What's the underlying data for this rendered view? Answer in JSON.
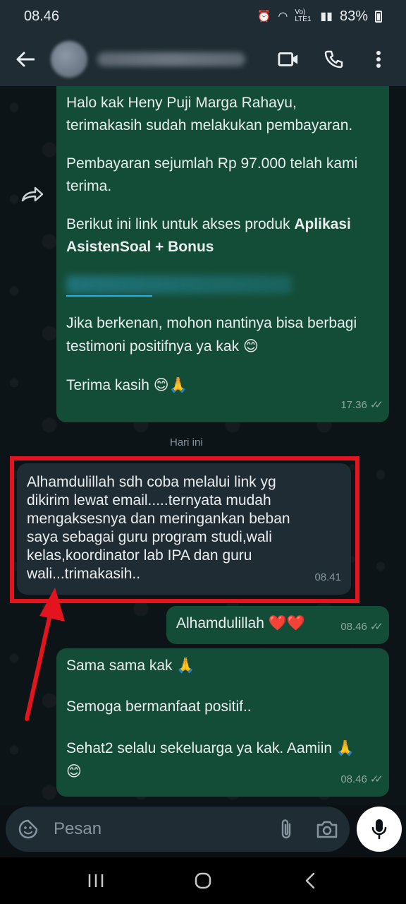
{
  "status": {
    "time": "08.46",
    "battery": "83%",
    "network": "Vo) LTE1"
  },
  "header": {
    "icons": [
      "back-arrow-icon",
      "video-call-icon",
      "voice-call-icon",
      "more-options-icon"
    ]
  },
  "messages": [
    {
      "direction": "outgoing",
      "lines_intro": "Halo kak Heny Puji Marga Rahayu,\nterimakasih sudah melakukan pembayaran.",
      "lines_payment": "Pembayaran sejumlah Rp 97.000 telah kami\nterima.",
      "lines_link_prefix": "Berikut ini link untuk akses produk ",
      "lines_link_bold_1": "Aplikasi",
      "lines_link_bold_2": "AsistenSoal + Bonus",
      "lines_testimoni": "Jika berkenan, mohon nantinya bisa berbagi\ntestimoni positifnya ya kak",
      "emoji_smile": "😊",
      "lines_thanks": "Terima kasih",
      "emoji_pray": "🙏",
      "time": "17.36"
    },
    {
      "direction": "incoming",
      "text": "Alhamdulillah sdh coba melalui link yg\ndikirim lewat email.....ternyata mudah\nmengaksesnya dan meringankan beban\nsaya sebagai guru program studi,wali\nkelas,koordinator lab IPA dan guru\nwali...trimakasih..",
      "time": "08.41"
    },
    {
      "direction": "outgoing",
      "text": "Alhamdulillah",
      "emoji": "❤️❤️",
      "time": "08.46"
    },
    {
      "direction": "outgoing",
      "line1": "Sama sama kak",
      "line2": "Semoga bermanfaat positif..",
      "line3": "Sehat2 selalu sekeluarga ya kak. Aamiin",
      "emoji_pray": "🙏",
      "emoji_smile": "😊",
      "time": "08.46"
    }
  ],
  "day_separator": "Hari ini",
  "input": {
    "placeholder": "Pesan"
  },
  "colors": {
    "outgoing_bubble": "#144d37",
    "incoming_bubble": "#1f2c33",
    "highlight": "#e3141d",
    "header": "#1f2c33"
  }
}
